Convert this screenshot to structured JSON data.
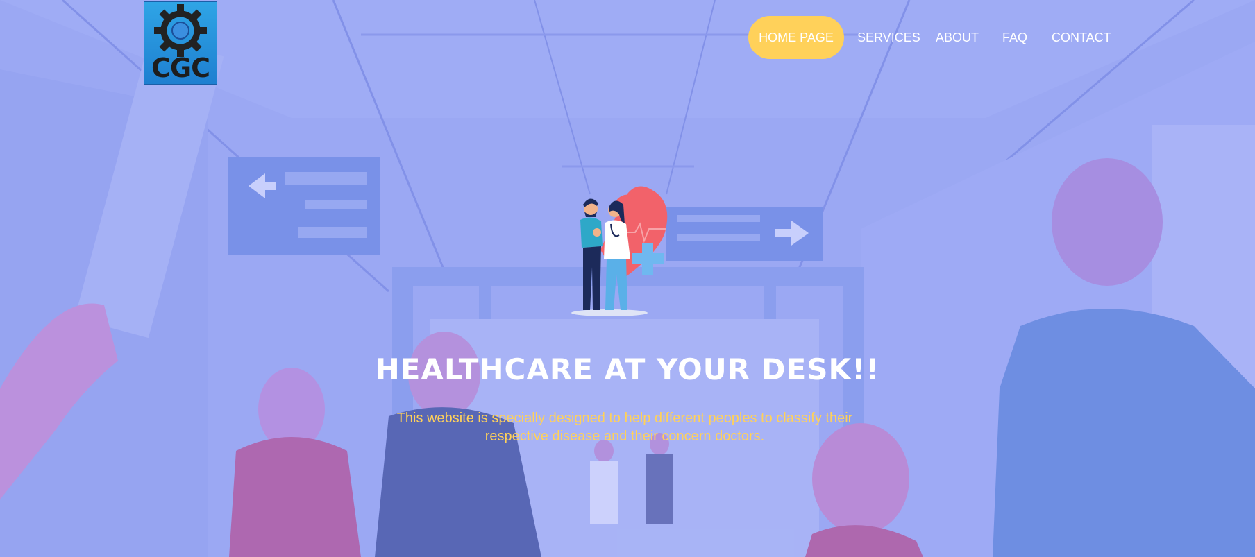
{
  "brand": {
    "logo_text": "CGC",
    "accent_color": "#ffd15a",
    "overlay_color": "#8c96f5"
  },
  "nav": {
    "items": [
      {
        "label": "HOME PAGE",
        "active": true
      },
      {
        "label": "SERVICES",
        "active": false
      },
      {
        "label": "ABOUT",
        "active": false
      },
      {
        "label": "FAQ",
        "active": false
      },
      {
        "label": "CONTACT",
        "active": false
      }
    ]
  },
  "hero": {
    "title": "HEALTHCARE AT YOUR DESK!!",
    "subtitle_line1": "This website is specially designed to help different peoples to classify their",
    "subtitle_line2": "respective disease and their concern doctors.",
    "illustration_icon": "doctor-patient-heart-icon"
  }
}
